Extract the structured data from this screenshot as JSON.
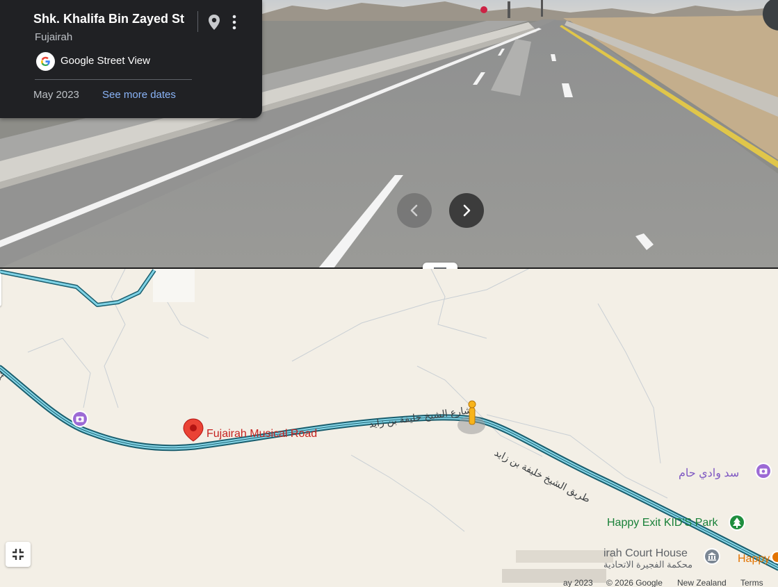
{
  "street_view": {
    "title": "Shk. Khalifa Bin Zayed St",
    "subtitle": "Fujairah",
    "provider": "Google Street View",
    "date": "May 2023",
    "see_more_dates": "See more dates",
    "icons": {
      "pin": "location-pin-icon",
      "menu": "more-vert-icon",
      "prev": "chevron-left-icon",
      "next": "chevron-right-icon"
    }
  },
  "map": {
    "pois": {
      "musical_road": "Fujairah Musical Road",
      "dam": "سد وادي حام",
      "kids_park": "Happy Exit KID'S Park",
      "court_en": "irah Court House",
      "court_ar": "محكمة الفجيرة الاتحادية",
      "happy_partial": "Happy"
    },
    "roads": {
      "main_ar_1": "شارع الشيخ خليفة بن زايد",
      "main_ar_2": "طريق الشيخ خليفة بن زايد",
      "edge_label": "St"
    },
    "footer": {
      "date": "ay 2023",
      "copyright": "© 2026 Google",
      "region": "New Zealand",
      "terms": "Terms"
    }
  },
  "colors": {
    "card_bg": "#202124",
    "link": "#8ab4f8",
    "route_outer": "#1a5e6e",
    "route_inner": "#7fd3e6",
    "map_bg": "#f3efe6",
    "poi_red": "#c5221f",
    "poi_purple": "#7e57c2",
    "poi_green": "#188038"
  }
}
